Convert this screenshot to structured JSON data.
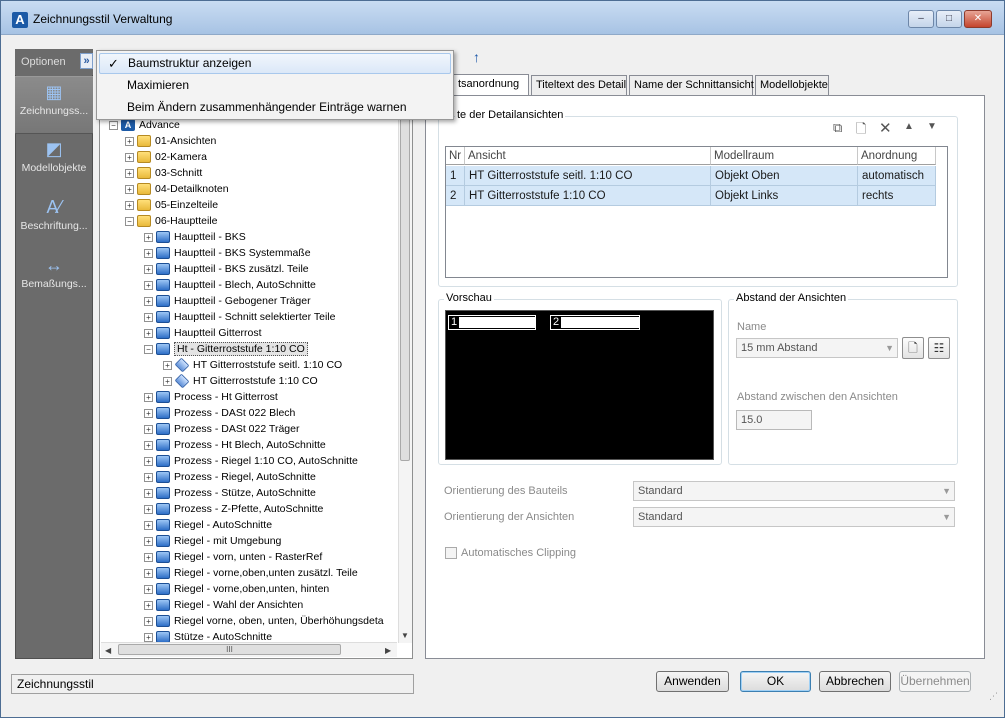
{
  "window": {
    "title": "Zeichnungsstil Verwaltung",
    "btn_min": "‒",
    "btn_max": "□",
    "btn_close": "✕"
  },
  "options": {
    "label": "Optionen",
    "chevron": "»"
  },
  "menu": {
    "items": [
      {
        "label": "Baumstruktur anzeigen",
        "checked": "✓"
      },
      {
        "label": "Maximieren",
        "checked": ""
      },
      {
        "label": "Beim Ändern zusammenhängender Einträge warnen",
        "checked": ""
      }
    ]
  },
  "nav": {
    "items": [
      {
        "label": "Zeichnungss...",
        "icon": "drawing-style-icon"
      },
      {
        "label": "Modellobjekte",
        "icon": "model-objects-icon"
      },
      {
        "label": "Beschriftung...",
        "icon": "labeling-icon"
      },
      {
        "label": "Bemaßungs...",
        "icon": "dimension-icon"
      }
    ]
  },
  "tree": {
    "root": "Advance",
    "items": [
      "01-Ansichten",
      "02-Kamera",
      "03-Schnitt",
      "04-Detailknoten",
      "05-Einzelteile",
      "06-Hauptteile",
      "Hauptteil - BKS",
      "Hauptteil - BKS Systemmaße",
      "Hauptteil - BKS zusätzl. Teile",
      "Hauptteil - Blech, AutoSchnitte",
      "Hauptteil - Gebogener Träger",
      "Hauptteil - Schnitt selektierter Teile",
      "Hauptteil Gitterrost",
      "Ht - Gitterroststufe 1:10 CO",
      "HT Gitterroststufe seitl. 1:10 CO",
      "HT Gitterroststufe 1:10 CO",
      "Process - Ht Gitterrost",
      "Prozess - DASt 022 Blech",
      "Prozess - DASt 022 Träger",
      "Prozess - Ht Blech, AutoSchnitte",
      "Prozess - Riegel 1:10 CO, AutoSchnitte",
      "Prozess - Riegel, AutoSchnitte",
      "Prozess - Stütze, AutoSchnitte",
      "Prozess - Z-Pfette, AutoSchnitte",
      "Riegel - AutoSchnitte",
      "Riegel - mit Umgebung",
      "Riegel - vorn, unten - RasterRef",
      "Riegel - vorne,oben,unten zusätzl. Teile",
      "Riegel - vorne,oben,unten, hinten",
      "Riegel - Wahl der Ansichten",
      "Riegel vorne, oben, unten, Überhöhungsdeta",
      "Stütze - AutoSchnitte"
    ],
    "hscroll_thumb": "III"
  },
  "tabs": [
    "tsanordnung",
    "Titeltext des Detail",
    "Name der Schnittansicht",
    "Modellobjekte"
  ],
  "details": {
    "group_label": "te der Detailansichten",
    "columns": [
      "Nr",
      "Ansicht",
      "Modellraum",
      "Anordnung"
    ],
    "rows": [
      {
        "nr": "1",
        "ansicht": "HT Gitterroststufe seitl. 1:10 CO",
        "modellraum": "Objekt Oben",
        "anordnung": "automatisch"
      },
      {
        "nr": "2",
        "ansicht": "HT Gitterroststufe 1:10 CO",
        "modellraum": "Objekt Links",
        "anordnung": "rechts"
      }
    ]
  },
  "preview": {
    "label": "Vorschau",
    "box1": "1",
    "box2": "2"
  },
  "spacing": {
    "group_label": "Abstand der Ansichten",
    "name_label": "Name",
    "name_value": "15 mm Abstand",
    "distance_label": "Abstand zwischen den Ansichten",
    "distance_value": "15.0"
  },
  "orientation": {
    "part_label": "Orientierung des Bauteils",
    "part_value": "Standard",
    "views_label": "Orientierung der Ansichten",
    "views_value": "Standard"
  },
  "clipping": {
    "label": "Automatisches Clipping"
  },
  "statusbar": {
    "text": "Zeichnungsstil"
  },
  "buttons": {
    "apply": "Anwenden",
    "ok": "OK",
    "cancel": "Abbrechen",
    "adopt": "Übernehmen"
  }
}
